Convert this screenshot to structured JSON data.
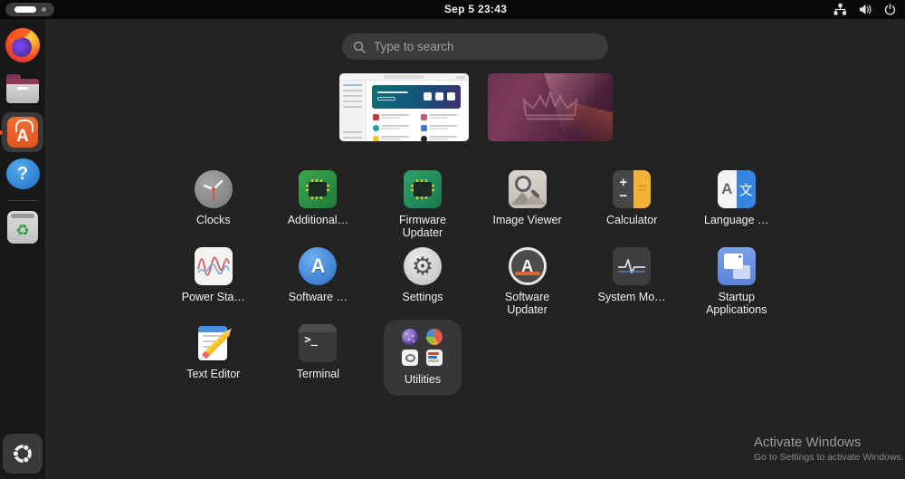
{
  "topbar": {
    "clock": "Sep 5 23:43",
    "workspaces_total": 2,
    "active_workspace": 1,
    "status_icons": [
      "network",
      "volume",
      "power"
    ]
  },
  "dock": {
    "items": [
      {
        "id": "firefox",
        "label": "Firefox"
      },
      {
        "id": "files",
        "label": "Files"
      },
      {
        "id": "app-center",
        "label": "App Center",
        "running": true,
        "focused": true
      },
      {
        "id": "help",
        "label": "Help"
      },
      {
        "id": "trash",
        "label": "Trash"
      }
    ],
    "show_apps": {
      "id": "ubuntu-desktop",
      "label": "Ubuntu"
    },
    "trash_glyph": "♻",
    "help_glyph": "?",
    "appcenter_glyph": "A"
  },
  "search": {
    "placeholder": "Type to search"
  },
  "workspaces": {
    "count": 2,
    "thumb1": "app-center-window",
    "thumb2": "ubuntu-wallpaper"
  },
  "apps": [
    {
      "label": "Clocks"
    },
    {
      "label": "Additional…"
    },
    {
      "label": "Firmware Updater"
    },
    {
      "label": "Image Viewer"
    },
    {
      "label": "Calculator"
    },
    {
      "label": "Language …"
    },
    {
      "label": "Power Sta…"
    },
    {
      "label": "Software …"
    },
    {
      "label": "Settings"
    },
    {
      "label": "Software Updater"
    },
    {
      "label": "System Mo…"
    },
    {
      "label": "Startup Applications"
    },
    {
      "label": "Text Editor"
    },
    {
      "label": "Terminal"
    }
  ],
  "folder": {
    "label": "Utilities"
  },
  "glyphs": {
    "calc_plus": "+",
    "calc_minus": "−",
    "calc_eq": "=",
    "lang_a": "A",
    "lang_cjk": "文",
    "swprop_a": "A",
    "swupd_a": "A",
    "settings_gear": "⚙",
    "terminal_prompt": "&gt;_"
  },
  "watermark": {
    "title": "Activate Windows",
    "subtitle": "Go to Settings to activate Windows."
  },
  "colors": {
    "accent_orange": "#e95420",
    "background": "#232323",
    "dock": "#181818",
    "topbar": "#090909",
    "search_bg": "#3b3b3b",
    "folder_bg": "#373737"
  }
}
